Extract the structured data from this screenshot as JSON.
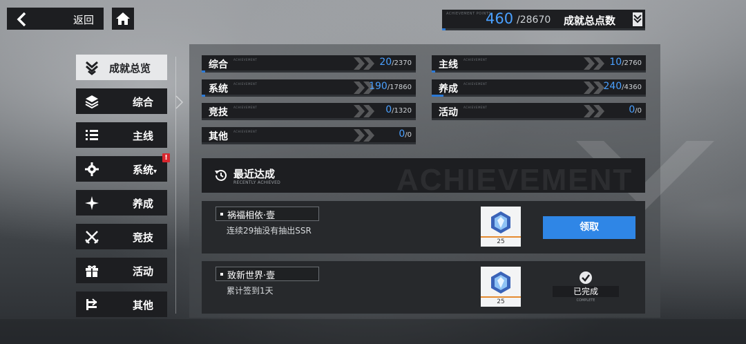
{
  "top": {
    "back_label": "返回",
    "total": {
      "current": "460",
      "max": "/28670",
      "label": "成就总点数",
      "tiny": "ACHIEVEMENT POINTS",
      "progress": 0.016
    }
  },
  "nav": {
    "items": [
      {
        "label": "成就总览",
        "icon": "chevron-stack-icon",
        "active": true
      },
      {
        "label": "综合",
        "icon": "layers-icon"
      },
      {
        "label": "主线",
        "icon": "list-icon"
      },
      {
        "label": "系统",
        "icon": "gear-icon",
        "suffix": "▾",
        "alert": "!"
      },
      {
        "label": "养成",
        "icon": "sparkle-icon"
      },
      {
        "label": "竞技",
        "icon": "crossed-swords-icon"
      },
      {
        "label": "活动",
        "icon": "gift-icon"
      },
      {
        "label": "其他",
        "icon": "misc-icon"
      }
    ]
  },
  "stats": [
    {
      "name": "综合",
      "value": "20",
      "max": "/2370",
      "progress": 0.0084,
      "tiny": "ACHIEVEMENT"
    },
    {
      "name": "主线",
      "value": "10",
      "max": "/2760",
      "progress": 0.0036,
      "tiny": "ACHIEVEMENT"
    },
    {
      "name": "系统",
      "value": "190",
      "max": "/17860",
      "progress": 0.0106,
      "tiny": "ACHIEVEMENT"
    },
    {
      "name": "养成",
      "value": "240",
      "max": "/4360",
      "progress": 0.055,
      "tiny": "ACHIEVEMENT"
    },
    {
      "name": "竞技",
      "value": "0",
      "max": "/1320",
      "progress": 0,
      "tiny": "ACHIEVEMENT"
    },
    {
      "name": "活动",
      "value": "0",
      "max": "/0",
      "progress": 0,
      "tiny": "ACHIEVEMENT"
    },
    {
      "name": "其他",
      "value": "0",
      "max": "/0",
      "progress": 0,
      "tiny": "ACHIEVEMENT"
    }
  ],
  "recent": {
    "title": "最近达成",
    "subtitle": "RECENTLY ACHIEVED",
    "watermark": "ACHIEVEMENT"
  },
  "cards": [
    {
      "title": "祸福相依·壹",
      "desc": "连续29抽没有抽出SSR",
      "reward_qty": "25",
      "action": "领取"
    },
    {
      "title": "致新世界·壹",
      "desc": "累计签到1天",
      "reward_qty": "25",
      "status": "已完成",
      "status_sub": "COMPLETE"
    }
  ],
  "colors": {
    "accent": "#2f86e6",
    "panel": "#1d1e21",
    "alert": "#d8262d"
  }
}
